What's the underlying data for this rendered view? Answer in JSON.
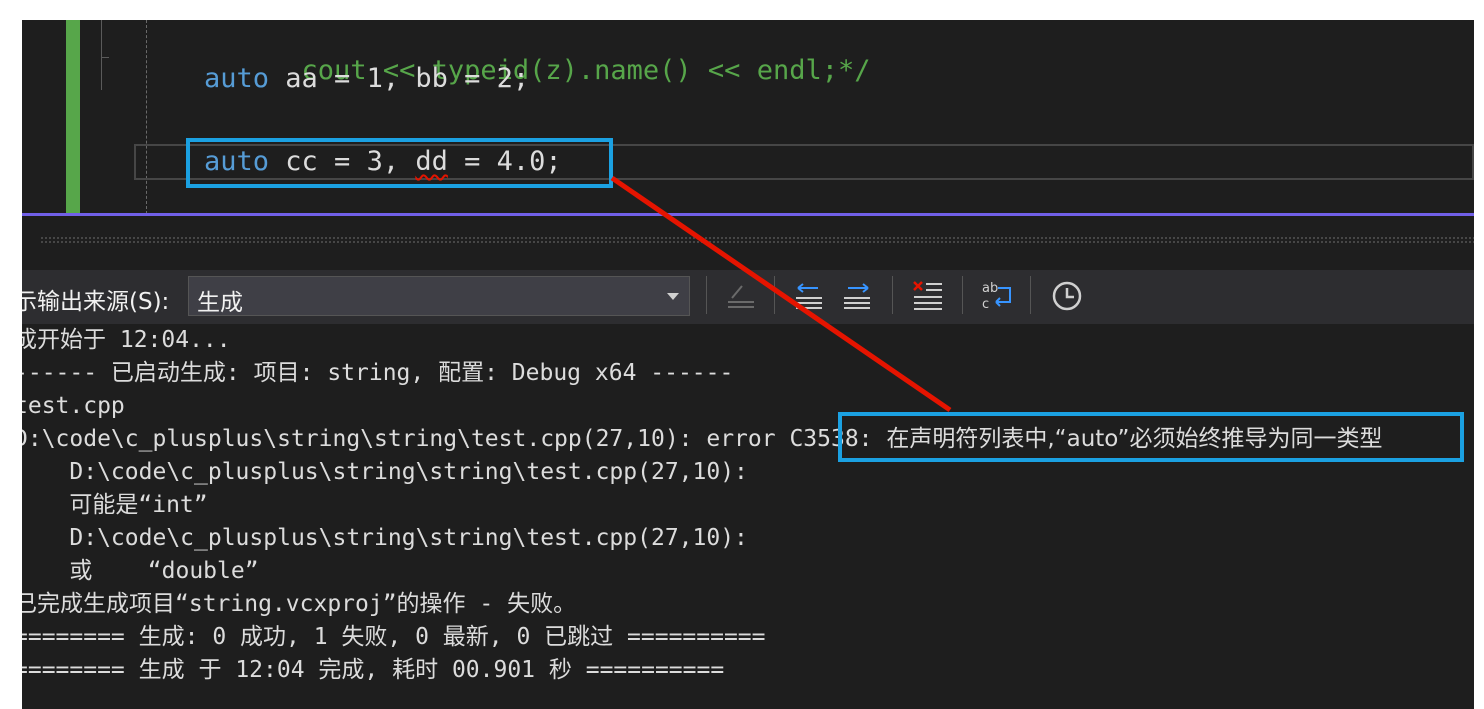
{
  "code": {
    "line1": {
      "name": "cout << typeid(z).name() << endl;*/"
    },
    "line2": {
      "kw": "auto",
      "rest": " aa = 1, bb = 2;"
    },
    "line3": {
      "kw": "auto",
      "a": " cc = 3, ",
      "err": "dd",
      "b": " = 4.0;"
    }
  },
  "toolbar": {
    "label": "示输出来源(S):",
    "source": "生成"
  },
  "output": {
    "lines": [
      "成开始于 12:04...",
      "------ 已启动生成: 项目: string, 配置: Debug x64 ------",
      "test.cpp",
      "D:\\code\\c_plusplus\\string\\string\\test.cpp(27,10): error C3538: ",
      "    D:\\code\\c_plusplus\\string\\string\\test.cpp(27,10):",
      "    可能是“int”",
      "    D:\\code\\c_plusplus\\string\\string\\test.cpp(27,10):",
      "    或    “double”",
      "已完成生成项目“string.vcxproj”的操作 - 失败。",
      "======== 生成: 0 成功, 1 失败, 0 最新, 0 已跳过 ==========",
      "======== 生成 于 12:04 完成, 耗时 00.901 秒 =========="
    ],
    "error_message": "在声明符列表中,“auto”必须始终推导为同一类型"
  },
  "colors": {
    "accent": "#1ba1e2",
    "annotation_arrow": "#e51400",
    "splitter": "#7160e8"
  },
  "icons": [
    "go-to-previous-message-icon",
    "go-to-next-message-icon",
    "clear-all-icon",
    "word-wrap-icon",
    "history-icon"
  ]
}
